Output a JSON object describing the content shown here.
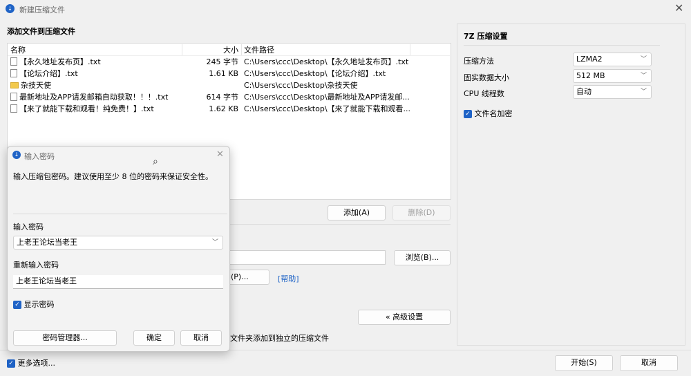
{
  "window": {
    "title": "新建压缩文件"
  },
  "main": {
    "section_title": "添加文件到压缩文件",
    "columns": {
      "name": "名称",
      "size": "大小",
      "path": "文件路径"
    },
    "files": [
      {
        "name": "【永久地址发布页】.txt",
        "size": "245 字节",
        "path": "C:\\Users\\ccc\\Desktop\\【永久地址发布页】.txt",
        "icon": "text-file-icon"
      },
      {
        "name": "【论坛介绍】.txt",
        "size": "1.61 KB",
        "path": "C:\\Users\\ccc\\Desktop\\【论坛介绍】.txt",
        "icon": "text-file-icon"
      },
      {
        "name": "杂技天使",
        "size": "",
        "path": "C:\\Users\\ccc\\Desktop\\杂技天使",
        "icon": "folder-icon"
      },
      {
        "name": "最新地址及APP请发邮箱自动获取！！！.txt",
        "size": "614 字节",
        "path": "C:\\Users\\ccc\\Desktop\\最新地址及APP请发邮...",
        "icon": "text-file-icon"
      },
      {
        "name": "【来了就能下载和观看！纯免费！】.txt",
        "size": "1.62 KB",
        "path": "C:\\Users\\ccc\\Desktop\\【来了就能下载和观看...",
        "icon": "text-file-icon"
      }
    ],
    "add_button": "添加(A)",
    "delete_button": "删除(D)",
    "browse_button": "浏览(B)...",
    "password_button_partial": "(P)...",
    "help_link": "[帮助]",
    "advanced_button": "« 高级设置",
    "separate_archive_text": "文件夹添加到独立的压缩文件",
    "more_options": "更多选项...",
    "start_button": "开始(S)",
    "cancel_button": "取消"
  },
  "settings": {
    "title": "7Z 压缩设置",
    "method_label": "压缩方法",
    "method_value": "LZMA2",
    "dict_label": "固实数据大小",
    "dict_value": "512 MB",
    "threads_label": "CPU 线程数",
    "threads_value": "自动",
    "encrypt_names": "文件名加密"
  },
  "dialog": {
    "title": "输入密码",
    "hint": "输入压缩包密码。建议使用至少 8 位的密码来保证安全性。",
    "password_label": "输入密码",
    "password_value": "上老王论坛当老王",
    "confirm_label": "重新输入密码",
    "confirm_value": "上老王论坛当老王",
    "show_password": "显示密码",
    "manager_button": "密码管理器...",
    "ok_button": "确定",
    "cancel_button": "取消"
  }
}
